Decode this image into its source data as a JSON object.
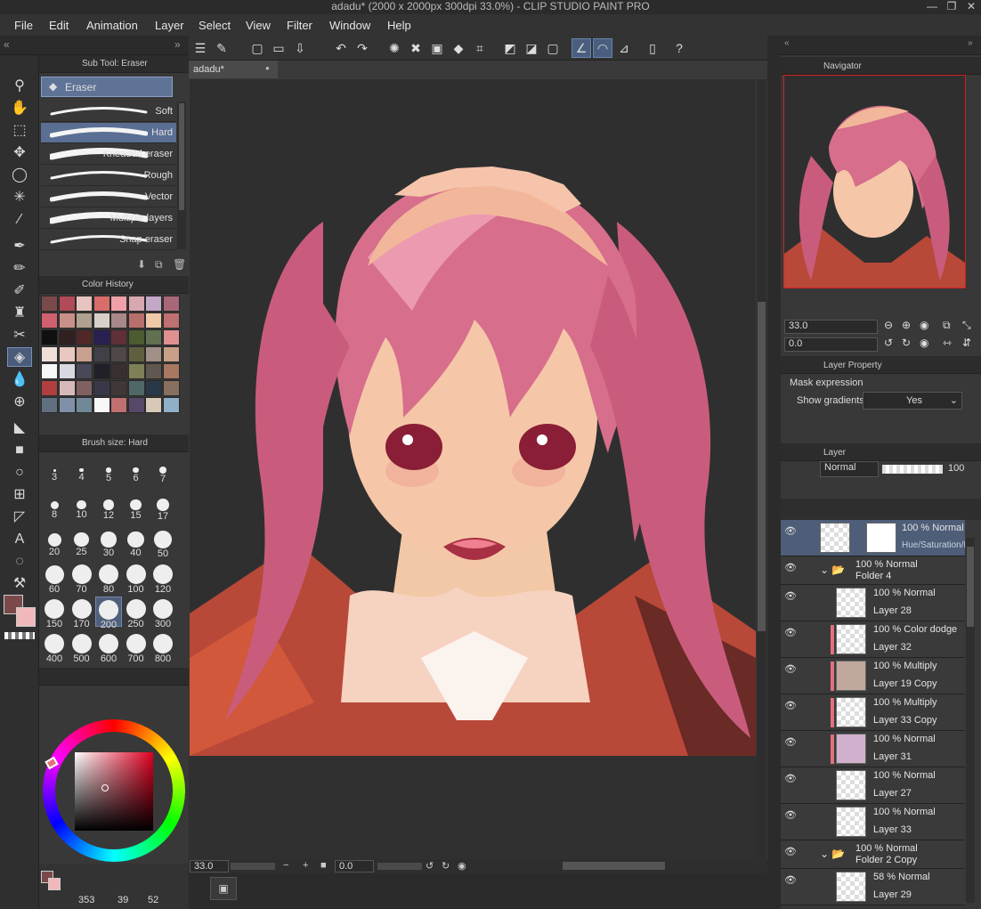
{
  "window": {
    "title": "adadu* (2000 x 2000px 300dpi 33.0%) - CLIP STUDIO PAINT PRO",
    "controls": [
      "—",
      "❐",
      "✕"
    ]
  },
  "menu": [
    "File",
    "Edit",
    "Animation",
    "Layer",
    "Select",
    "View",
    "Filter",
    "Window",
    "Help"
  ],
  "document": {
    "tab": "adadu*",
    "tab_dot": "●"
  },
  "subtool": {
    "header": "Sub Tool: Eraser",
    "group": "Eraser",
    "items": [
      "Soft",
      "Hard",
      "Kneaded eraser",
      "Rough",
      "Vector",
      "Multiple layers",
      "Snap eraser"
    ],
    "selected": "Hard"
  },
  "color_history": {
    "header": "Color History",
    "colors": [
      "#7a4a4a",
      "#b04b57",
      "#e8c4c0",
      "#d86d6a",
      "#f0a0a8",
      "#d8a8b0",
      "#c4a8c8",
      "#a86878",
      "#d06070",
      "#c89088",
      "#b0a090",
      "#d8d0c8",
      "#a88888",
      "#b8706c",
      "#f0c8a8",
      "#c07070",
      "#101010",
      "#302020",
      "#502828",
      "#282050",
      "#603038",
      "#4c5c30",
      "#607050",
      "#e09090",
      "#f0e0d8",
      "#e8c8c0",
      "#c8a090",
      "#404048",
      "#504848",
      "#606040",
      "#a09088",
      "#c8a088",
      "#f8f8f8",
      "#d8d8e0",
      "#484858",
      "#202028",
      "#383030",
      "#808058",
      "#605850",
      "#a87860",
      "#b04040",
      "#d8b8b8",
      "#806060",
      "#383848",
      "#403838",
      "#506868",
      "#283848",
      "#887060",
      "#607080",
      "#8090a8",
      "#708898",
      "#f8f8f8",
      "#c07070",
      "#584868",
      "#d8c8b8",
      "#90b0c8"
    ]
  },
  "brush_size": {
    "header": "Brush size: Hard",
    "sizes": [
      "3",
      "4",
      "5",
      "6",
      "7",
      "8",
      "10",
      "12",
      "15",
      "17",
      "20",
      "25",
      "30",
      "40",
      "50",
      "60",
      "70",
      "80",
      "100",
      "120",
      "150",
      "170",
      "200",
      "250",
      "300",
      "400",
      "500",
      "600",
      "700",
      "800"
    ],
    "selected": "200"
  },
  "navigator": {
    "header": "Navigator",
    "zoom": "33.0",
    "rotation": "0.0"
  },
  "layer_property": {
    "header": "Layer Property",
    "mask_expression": "Mask expression",
    "show_gradients": "Show gradients",
    "gradients_value": "Yes"
  },
  "layer_panel": {
    "header": "Layer",
    "blend_mode": "Normal",
    "opacity": "100",
    "layers": [
      {
        "mode": "100 % Normal",
        "name": "Hue/Saturation/L...",
        "type": "adjust"
      },
      {
        "mode": "100 % Normal",
        "name": "Folder 4",
        "type": "folder"
      },
      {
        "mode": "100 % Normal",
        "name": "Layer 28",
        "type": "layer",
        "thumb": "#ffffff",
        "red": false
      },
      {
        "mode": "100 % Color dodge",
        "name": "Layer 32",
        "type": "layer",
        "thumb": "#ffffff",
        "red": true
      },
      {
        "mode": "100 % Multiply",
        "name": "Layer 19 Copy",
        "type": "layer",
        "thumb": "#c0a89c",
        "red": true
      },
      {
        "mode": "100 % Multiply",
        "name": "Layer 33 Copy",
        "type": "layer",
        "thumb": "#ffffff",
        "red": true
      },
      {
        "mode": "100 % Normal",
        "name": "Layer 31",
        "type": "layer",
        "thumb": "#d0b0cc",
        "red": true
      },
      {
        "mode": "100 % Normal",
        "name": "Layer 27",
        "type": "layer",
        "thumb": "#ffffff",
        "red": false
      },
      {
        "mode": "100 % Normal",
        "name": "Layer 33",
        "type": "layer",
        "thumb": "#ffffff",
        "red": false
      },
      {
        "mode": "100 % Normal",
        "name": "Folder 2 Copy",
        "type": "folder"
      },
      {
        "mode": "58 % Normal",
        "name": "Layer 29",
        "type": "layer",
        "thumb": "#ffffff",
        "red": false
      }
    ]
  },
  "status": {
    "zoom": "33.0",
    "rotation": "0.0",
    "memory": "353",
    "val1": "39",
    "val2": "52"
  },
  "colors": {
    "main": "#7a4a4a",
    "sub": "#f0b8b8",
    "hue_marker": "#e0717c"
  }
}
